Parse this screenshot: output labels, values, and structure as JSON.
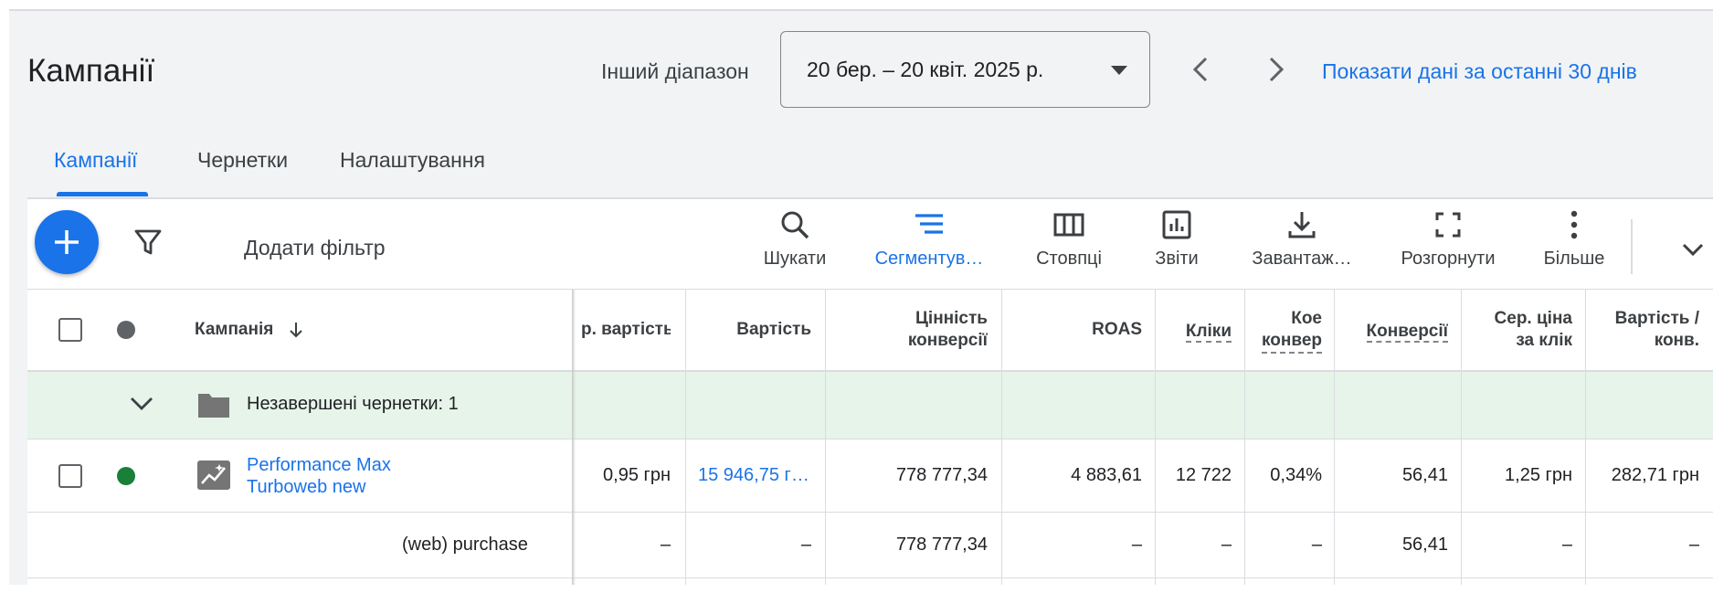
{
  "header": {
    "title": "Кампанії",
    "range_label": "Інший діапазон",
    "date_range": "20 бер. – 20 квіт. 2025 р.",
    "show_last_30": "Показати дані за останні 30 днів"
  },
  "tabs": [
    {
      "label": "Кампанії",
      "active": true
    },
    {
      "label": "Чернетки",
      "active": false
    },
    {
      "label": "Налаштування",
      "active": false
    }
  ],
  "toolbar": {
    "add_filter": "Додати фільтр",
    "search": "Шукати",
    "segment": "Сегментув…",
    "columns": "Стовпці",
    "reports": "Звіти",
    "download": "Завантаж…",
    "expand": "Розгорнути",
    "more": "Більше"
  },
  "table": {
    "headers": {
      "campaign": "Кампанія",
      "avg_cost": "р. вартість",
      "cost": "Вартість",
      "conv_value_1": "Цінність",
      "conv_value_2": "конверсії",
      "roas": "ROAS",
      "clicks": "Кліки",
      "conv_rate_1": "Кое",
      "conv_rate_2": "конвер",
      "conversions": "Конверсії",
      "avg_cpc_1": "Сер. ціна",
      "avg_cpc_2": "за клік",
      "cost_conv_1": "Вартість /",
      "cost_conv_2": "конв."
    },
    "draft_row": {
      "label": "Незавершені чернетки: 1"
    },
    "campaign_row": {
      "name_line1": "Performance Max",
      "name_line2": "Turboweb new",
      "avg_cost": "0,95 грн",
      "cost": "15 946,75 г…",
      "conv_value": "778 777,34",
      "roas": "4 883,61",
      "clicks": "12 722",
      "conv_rate": "0,34%",
      "conversions": "56,41",
      "avg_cpc": "1,25 грн",
      "cost_conv": "282,71 грн"
    },
    "conversion_row": {
      "name": "(web) purchase",
      "avg_cost": "–",
      "cost": "–",
      "conv_value": "778 777,34",
      "roas": "–",
      "clicks": "–",
      "conv_rate": "–",
      "conversions": "56,41",
      "avg_cpc": "–",
      "cost_conv": "–"
    }
  },
  "colors": {
    "accent": "#1a73e8",
    "status_enabled": "#188038",
    "draft_row_bg": "#e6f4ea"
  }
}
